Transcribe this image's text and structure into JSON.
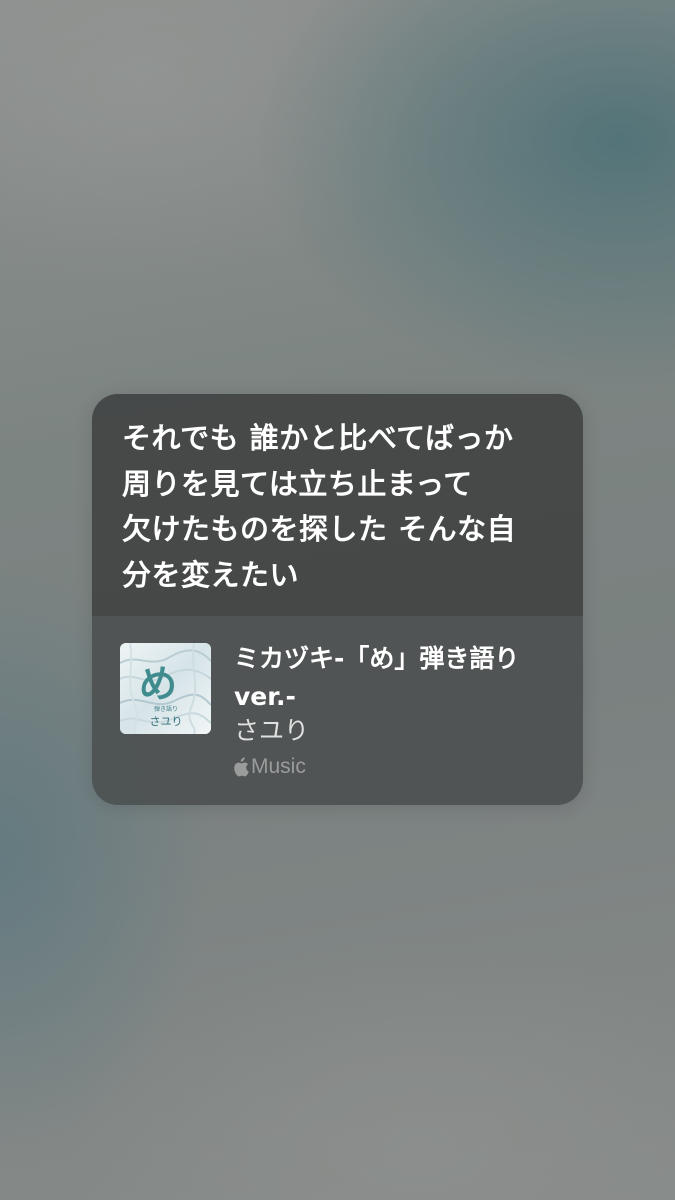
{
  "lyrics": {
    "text": "それでも 誰かと比べてばっか\n周りを見ては立ち止まって\n欠けたものを探した そんな自\n分を変えたい"
  },
  "track": {
    "title": "ミカヅキ-「め」弾き語り ver.-",
    "artist": "さユり",
    "album_art": {
      "title_glyph": "め",
      "subtitle_small": "弾き語り",
      "artist_text": "さユり"
    }
  },
  "service": {
    "label": "Music",
    "icon": "apple-logo-icon"
  },
  "colors": {
    "card_background": "#484a4a",
    "text_primary": "#ffffff",
    "album_glyph": "#3f8b8e"
  }
}
